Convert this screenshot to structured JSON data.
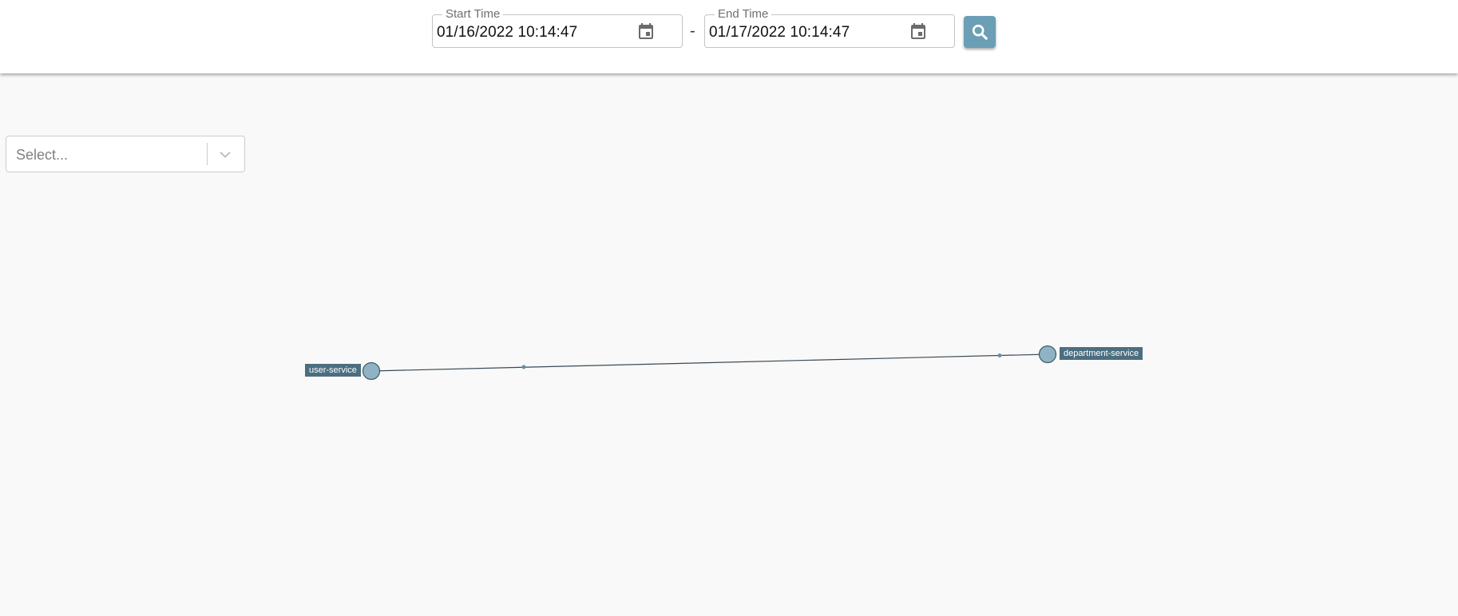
{
  "header": {
    "start_time": {
      "label": "Start Time",
      "value": "01/16/2022 10:14:47",
      "icon": "calendar-icon"
    },
    "separator": "-",
    "end_time": {
      "label": "End Time",
      "value": "01/17/2022 10:14:47",
      "icon": "calendar-icon"
    },
    "search_icon": "search-icon",
    "search_color": "#6a9fb5"
  },
  "filter": {
    "placeholder": "Select...",
    "icon": "chevron-down-icon"
  },
  "graph": {
    "nodes": [
      {
        "id": "user-service",
        "label": "user-service"
      },
      {
        "id": "department-service",
        "label": "department-service"
      }
    ],
    "edges": [
      {
        "from": "user-service",
        "to": "department-service"
      }
    ],
    "node_color": "#8fb3c4",
    "label_bg": "#4b6e80"
  }
}
